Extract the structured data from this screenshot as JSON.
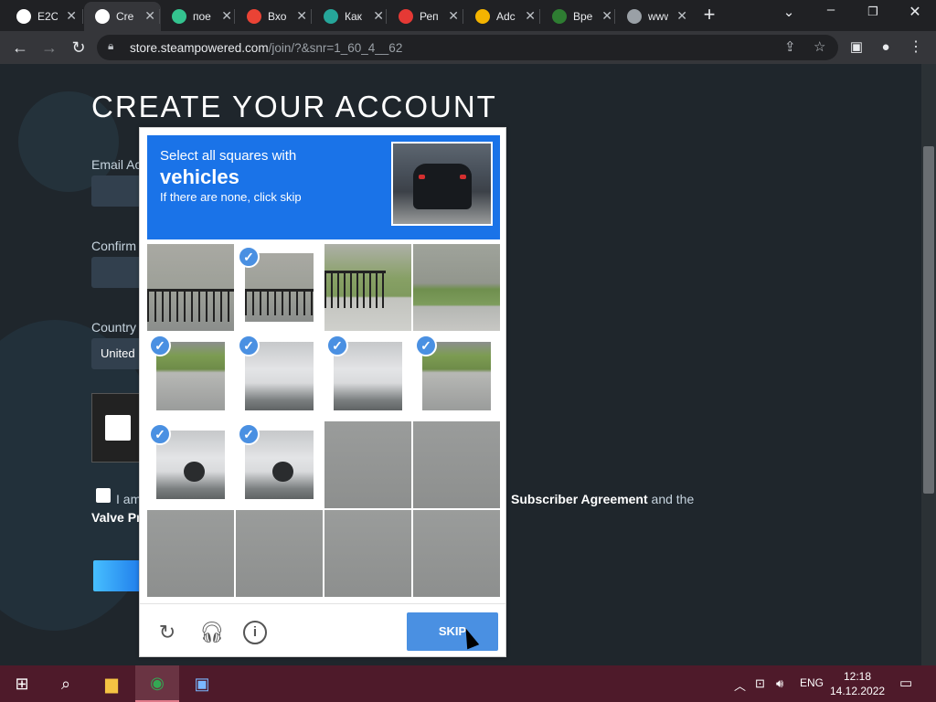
{
  "browser": {
    "tabs": [
      {
        "title": "E2C",
        "icon": "globe-icon",
        "color": "#ffffff"
      },
      {
        "title": "Cre",
        "icon": "steam-icon",
        "color": "#ffffff",
        "active": true
      },
      {
        "title": "пое",
        "icon": "v-icon",
        "color": "#34c38f"
      },
      {
        "title": "Вхо",
        "icon": "google-icon",
        "color": "#ea4335"
      },
      {
        "title": "Как",
        "icon": "coin-icon",
        "color": "#26a69a"
      },
      {
        "title": "Реп",
        "icon": "yandex-icon",
        "color": "#e53935"
      },
      {
        "title": "Adc",
        "icon": "microsoft-icon",
        "color": "#f4b400"
      },
      {
        "title": "Вре",
        "icon": "circle-icon",
        "color": "#2e7d32"
      },
      {
        "title": "www.na",
        "icon": "globe-icon",
        "color": "#9aa0a6"
      }
    ],
    "url_host": "store.steampowered.com",
    "url_path": "/join/?&snr=1_60_4__62"
  },
  "steam": {
    "heading": "CREATE YOUR ACCOUNT",
    "email_label": "Email Ac",
    "confirm_label": "Confirm",
    "country_label": "Country",
    "country_value": "United",
    "agree_text": "I am",
    "agree_link": "Subscriber Agreement",
    "agree_and": "and the",
    "valve_text": "Valve Pr"
  },
  "captcha": {
    "instruction": "Select all squares with",
    "target": "vehicles",
    "hint": "If there are none, click skip",
    "skip_label": "SKIP",
    "tiles": [
      {
        "img": "fence",
        "selected": false
      },
      {
        "img": "fence",
        "selected": true
      },
      {
        "img": "grassfence",
        "selected": false
      },
      {
        "img": "grass",
        "selected": false
      },
      {
        "img": "grassroad",
        "selected": true
      },
      {
        "img": "car",
        "selected": true
      },
      {
        "img": "car",
        "selected": true
      },
      {
        "img": "grassroad",
        "selected": true
      },
      {
        "img": "car a",
        "selected": true
      },
      {
        "img": "car a",
        "selected": true
      },
      {
        "img": "road",
        "selected": false
      },
      {
        "img": "road",
        "selected": false
      },
      {
        "img": "road",
        "selected": false
      },
      {
        "img": "road",
        "selected": false
      },
      {
        "img": "road",
        "selected": false
      },
      {
        "img": "road",
        "selected": false
      }
    ]
  },
  "taskbar": {
    "lang": "ENG",
    "time": "12:18",
    "date": "14.12.2022"
  }
}
